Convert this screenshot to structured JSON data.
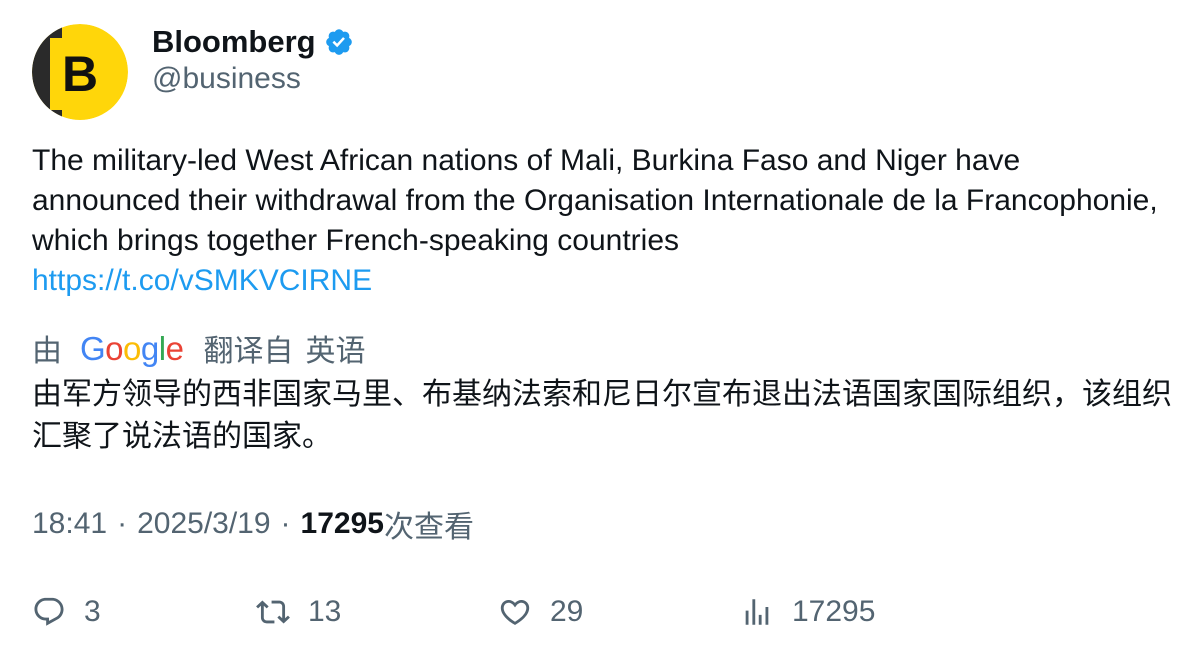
{
  "author": {
    "display_name": "Bloomberg",
    "handle": "@business",
    "avatar_letter": "B",
    "verified": true
  },
  "tweet": {
    "text": "The military-led West African nations of Mali, Burkina Faso and Niger have announced their withdrawal from the Organisation Internationale de la Francophonie, which brings together French-speaking countries",
    "link": "https://t.co/vSMKVCIRNE"
  },
  "translation": {
    "by_label": "由",
    "provider": "Google",
    "translated_from_label": "翻译自",
    "source_language": "英语",
    "text": "由军方领导的西非国家马里、布基纳法索和尼日尔宣布退出法语国家国际组织，该组织汇聚了说法语的国家。"
  },
  "meta": {
    "time": "18:41",
    "separator": "·",
    "date": "2025/3/19",
    "views_count": "17295",
    "views_label": "次查看"
  },
  "actions": {
    "reply_count": "3",
    "retweet_count": "13",
    "like_count": "29",
    "views_count": "17295"
  },
  "colors": {
    "link": "#1d9bf0",
    "secondary_text": "#536471",
    "primary_text": "#0f1419",
    "avatar_yellow": "#ffd60a",
    "verified_blue": "#1d9bf0"
  },
  "icons": [
    "verified-badge-icon",
    "reply-icon",
    "retweet-icon",
    "like-icon",
    "views-icon"
  ]
}
